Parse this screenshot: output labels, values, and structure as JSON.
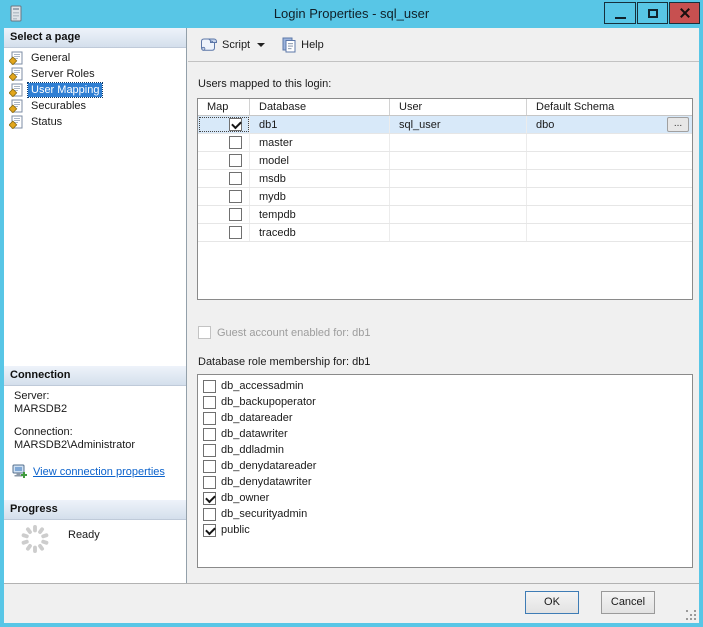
{
  "window": {
    "title": "Login Properties - sql_user",
    "controls": {
      "minimize": "minimize",
      "maximize": "maximize",
      "close": "close"
    }
  },
  "colors": {
    "titlebar": "#58c6e6",
    "close_button": "#c75050",
    "selection_blue": "#2f7fd3",
    "row_highlight": "#d8e9f9",
    "link": "#0b62cc"
  },
  "sidebar": {
    "select_page_header": "Select a page",
    "pages": [
      {
        "label": "General",
        "selected": false
      },
      {
        "label": "Server Roles",
        "selected": false
      },
      {
        "label": "User Mapping",
        "selected": true
      },
      {
        "label": "Securables",
        "selected": false
      },
      {
        "label": "Status",
        "selected": false
      }
    ],
    "connection_header": "Connection",
    "server_label": "Server:",
    "server_value": "MARSDB2",
    "connection_label": "Connection:",
    "connection_value": "MARSDB2\\Administrator",
    "view_link": "View connection properties",
    "progress_header": "Progress",
    "progress_status": "Ready"
  },
  "toolbar": {
    "script_label": "Script",
    "help_label": "Help"
  },
  "main": {
    "users_mapped_label": "Users mapped to this login:",
    "table": {
      "columns": [
        "Map",
        "Database",
        "User",
        "Default Schema"
      ],
      "ellipsis_label": "...",
      "rows": [
        {
          "map": true,
          "database": "db1",
          "user": "sql_user",
          "default_schema": "dbo",
          "selected": true,
          "ellipsis": true
        },
        {
          "map": false,
          "database": "master",
          "user": "",
          "default_schema": "",
          "selected": false,
          "ellipsis": false
        },
        {
          "map": false,
          "database": "model",
          "user": "",
          "default_schema": "",
          "selected": false,
          "ellipsis": false
        },
        {
          "map": false,
          "database": "msdb",
          "user": "",
          "default_schema": "",
          "selected": false,
          "ellipsis": false
        },
        {
          "map": false,
          "database": "mydb",
          "user": "",
          "default_schema": "",
          "selected": false,
          "ellipsis": false
        },
        {
          "map": false,
          "database": "tempdb",
          "user": "",
          "default_schema": "",
          "selected": false,
          "ellipsis": false
        },
        {
          "map": false,
          "database": "tracedb",
          "user": "",
          "default_schema": "",
          "selected": false,
          "ellipsis": false
        }
      ]
    },
    "guest_label": "Guest account enabled for: db1",
    "guest_checked": false,
    "guest_enabled": false,
    "role_label": "Database role membership for: db1",
    "roles": [
      {
        "name": "db_accessadmin",
        "checked": false
      },
      {
        "name": "db_backupoperator",
        "checked": false
      },
      {
        "name": "db_datareader",
        "checked": false
      },
      {
        "name": "db_datawriter",
        "checked": false
      },
      {
        "name": "db_ddladmin",
        "checked": false
      },
      {
        "name": "db_denydatareader",
        "checked": false
      },
      {
        "name": "db_denydatawriter",
        "checked": false
      },
      {
        "name": "db_owner",
        "checked": true
      },
      {
        "name": "db_securityadmin",
        "checked": false
      },
      {
        "name": "public",
        "checked": true
      }
    ]
  },
  "footer": {
    "ok_label": "OK",
    "cancel_label": "Cancel"
  }
}
